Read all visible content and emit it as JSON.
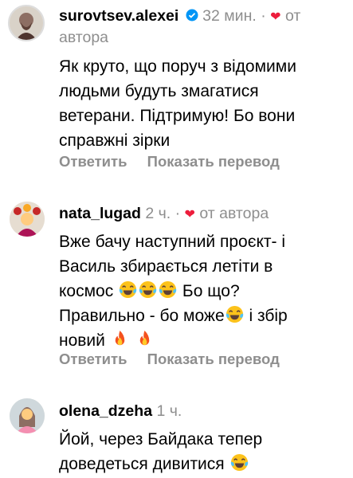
{
  "comments": [
    {
      "username": "surovtsev.alexei",
      "verified": true,
      "time": "32 мин.",
      "separator": "·",
      "liked_by_author_label": "от",
      "liked_by_author_label2": "автора",
      "text_lines": [
        "Як круто, що поруч з відомими",
        "людьми будуть змагатися",
        "ветерани. Підтримую! Бо вони",
        "справжні зірки"
      ],
      "reply_label": "Ответить",
      "translate_label": "Показать перевод"
    },
    {
      "username": "nata_lugad",
      "time": "2 ч.",
      "separator": "·",
      "liked_by_author_label": "от автора",
      "text_line1": "Вже бачу наступний проєкт- і",
      "text_line2": "Василь збирається летіти в",
      "text_line3": "космос",
      "text_line3b": "Бо що?",
      "text_line4": "Правильно - бо може",
      "text_line4b": "і збір",
      "text_line5": "новий",
      "reply_label": "Ответить",
      "translate_label": "Показать перевод"
    },
    {
      "username": "olena_dzeha",
      "time": "1 ч.",
      "text_line1": "Йой, через Байдака тепер",
      "text_line2": "доведеться дивитися"
    }
  ],
  "colors": {
    "heart": "#ed1d3c",
    "meta_gray": "#8e8e8e",
    "verified_blue": "#0095f6"
  },
  "icons": {
    "laugh": "face-with-tears-of-joy-icon",
    "fire": "fire-icon",
    "heart": "heart-icon",
    "verified": "verified-badge-icon"
  }
}
